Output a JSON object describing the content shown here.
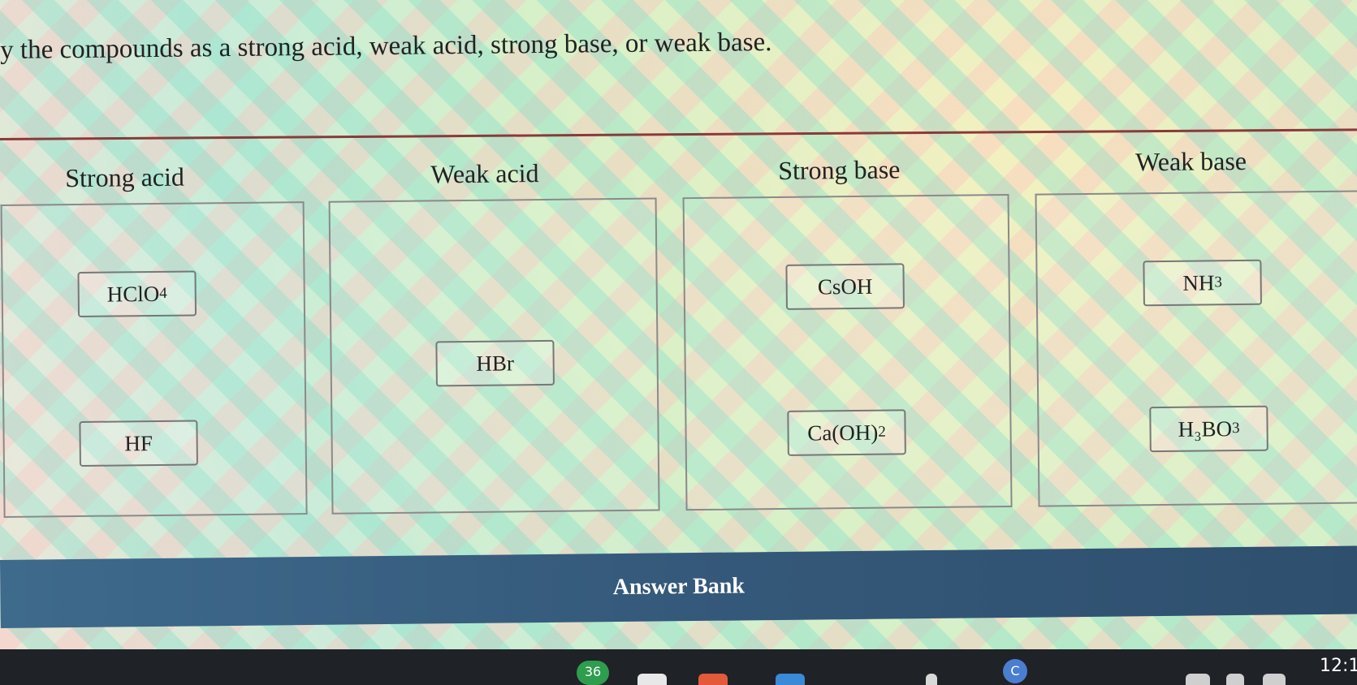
{
  "question": {
    "instruction": "y the compounds as a strong acid, weak acid, strong base, or weak base."
  },
  "categories": [
    {
      "label": "Strong acid"
    },
    {
      "label": "Weak acid"
    },
    {
      "label": "Strong base"
    },
    {
      "label": "Weak base"
    }
  ],
  "placed_items": {
    "strong_acid": [
      {
        "formula": "HClO",
        "sub": "4"
      },
      {
        "formula": "HF",
        "sub": ""
      }
    ],
    "weak_acid": [
      {
        "formula": "HBr",
        "sub": ""
      }
    ],
    "strong_base": [
      {
        "formula": "CsOH",
        "sub": ""
      },
      {
        "formula": "Ca(OH)",
        "sub": "2"
      }
    ],
    "weak_base": [
      {
        "formula": "NH",
        "sub": "3"
      },
      {
        "formula": "H₃BO",
        "sub": "3"
      }
    ]
  },
  "answer_bank": {
    "label": "Answer Bank"
  },
  "taskbar": {
    "badge_count": "36",
    "c_icon_letter": "C",
    "clock": "12:1"
  }
}
